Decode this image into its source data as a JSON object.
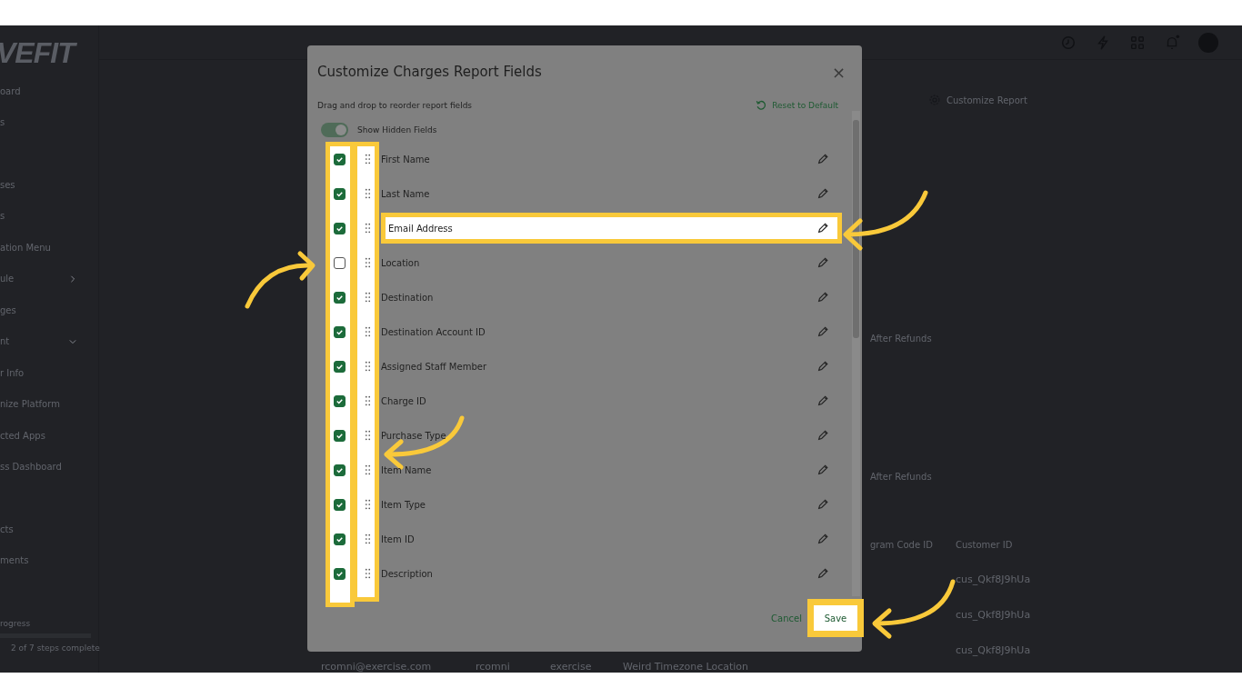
{
  "background": {
    "logo": "VEFIT",
    "sidebar_items": [
      {
        "label": "oard"
      },
      {
        "label": "s"
      },
      {
        "label": "ses"
      },
      {
        "label": "s"
      },
      {
        "label": "ation Menu"
      },
      {
        "label": "ule",
        "expanded": false
      },
      {
        "label": "ges"
      },
      {
        "label": "nt",
        "expanded": true
      },
      {
        "label": "r Info"
      },
      {
        "label": "nize Platform"
      },
      {
        "label": "cted Apps"
      },
      {
        "label": "ss Dashboard"
      },
      {
        "label": "cts"
      },
      {
        "label": "ments"
      }
    ],
    "progress": {
      "label": "rogress",
      "level": 1,
      "caption": "2 of 7 steps complete"
    },
    "customize_report": "Customize Report",
    "refund_labels": [
      "After Refunds",
      "After Refunds"
    ],
    "table": {
      "columns": [
        "gram Code ID",
        "Customer ID"
      ],
      "customer_ids": [
        "cus_Qkf8J9hUa",
        "cus_Qkf8J9hUa",
        "cus_Qkf8J9hUa"
      ],
      "bottom_row": [
        "rcomni@exercise.com",
        "rcomni",
        "exercise",
        "Weird Timezone Location"
      ]
    }
  },
  "dialog": {
    "title": "Customize Charges Report Fields",
    "close": "×",
    "hint": "Drag and drop to reorder report fields",
    "reset": "Reset to Default",
    "show_hidden": {
      "label": "Show Hidden Fields",
      "on": true
    },
    "fields": [
      {
        "label": "First Name",
        "checked": true,
        "highlighted": false
      },
      {
        "label": "Last Name",
        "checked": true,
        "highlighted": false
      },
      {
        "label": "Email Address",
        "checked": true,
        "highlighted": true
      },
      {
        "label": "Location",
        "checked": false,
        "highlighted": false
      },
      {
        "label": "Destination",
        "checked": true,
        "highlighted": false
      },
      {
        "label": "Destination Account ID",
        "checked": true,
        "highlighted": false
      },
      {
        "label": "Assigned Staff Member",
        "checked": true,
        "highlighted": false
      },
      {
        "label": "Charge ID",
        "checked": true,
        "highlighted": false
      },
      {
        "label": "Purchase Type",
        "checked": true,
        "highlighted": false
      },
      {
        "label": "Item Name",
        "checked": true,
        "highlighted": false
      },
      {
        "label": "Item Type",
        "checked": true,
        "highlighted": false
      },
      {
        "label": "Item ID",
        "checked": true,
        "highlighted": false
      },
      {
        "label": "Description",
        "checked": true,
        "highlighted": false
      }
    ],
    "cancel": "Cancel",
    "save": "Save"
  }
}
